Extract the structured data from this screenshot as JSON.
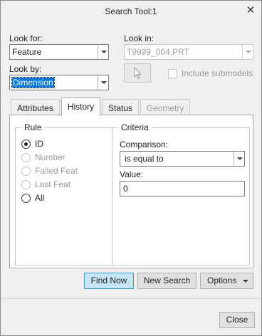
{
  "window": {
    "title": "Search Tool:1"
  },
  "look_for": {
    "label": "Look for:",
    "value": "Feature"
  },
  "look_in": {
    "label": "Look in:",
    "value": "T9999_004.PRT"
  },
  "look_by": {
    "label": "Look by:",
    "value": "Dimension"
  },
  "include_submodels": {
    "label": "Include submodels",
    "checked": false
  },
  "tabs": [
    {
      "label": "Attributes",
      "state": "normal"
    },
    {
      "label": "History",
      "state": "active"
    },
    {
      "label": "Status",
      "state": "normal"
    },
    {
      "label": "Geometry",
      "state": "disabled"
    }
  ],
  "rule": {
    "title": "Rule",
    "options": [
      {
        "label": "ID",
        "checked": true,
        "enabled": true
      },
      {
        "label": "Number",
        "checked": false,
        "enabled": false
      },
      {
        "label": "Failed Feat",
        "checked": false,
        "enabled": false
      },
      {
        "label": "Last Feat",
        "checked": false,
        "enabled": false
      },
      {
        "label": "All",
        "checked": false,
        "enabled": true
      }
    ]
  },
  "criteria": {
    "title": "Criteria",
    "comparison_label": "Comparison:",
    "comparison_value": "is equal to",
    "value_label": "Value:",
    "value": "0"
  },
  "actions": {
    "find_now": "Find Now",
    "new_search": "New Search",
    "options": "Options"
  },
  "footer": {
    "close": "Close"
  },
  "icons": {
    "close": "close-icon",
    "pick": "cursor-arrow-icon",
    "dropdown": "chevron-down-icon"
  }
}
